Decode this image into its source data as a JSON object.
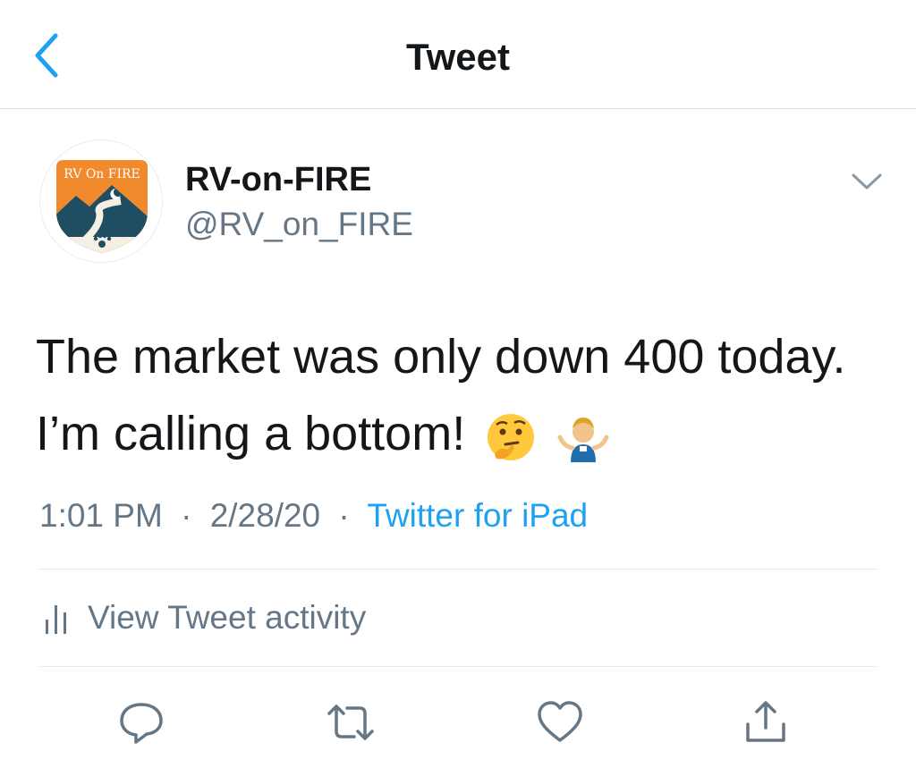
{
  "header": {
    "title": "Tweet",
    "back_icon": "chevron-left-icon"
  },
  "user": {
    "display_name": "RV-on-FIRE",
    "handle": "@RV_on_FIRE",
    "avatar_text": "RV On FIRE"
  },
  "tweet": {
    "text": "The market was only down 400 today. I’m calling a bottom!",
    "emojis": [
      "thinking-face-emoji",
      "shrugging-person-emoji"
    ],
    "time": "1:01 PM",
    "date": "2/28/20",
    "separator": "·",
    "source": "Twitter for iPad"
  },
  "activity": {
    "label": "View Tweet activity",
    "icon": "bar-chart-icon"
  },
  "actions": [
    "reply-icon",
    "retweet-icon",
    "like-icon",
    "share-icon"
  ],
  "colors": {
    "accent": "#1da1f2",
    "muted": "#657786",
    "text": "#14171a",
    "avatar_orange": "#f08a2c",
    "avatar_teal": "#1f4e63"
  }
}
